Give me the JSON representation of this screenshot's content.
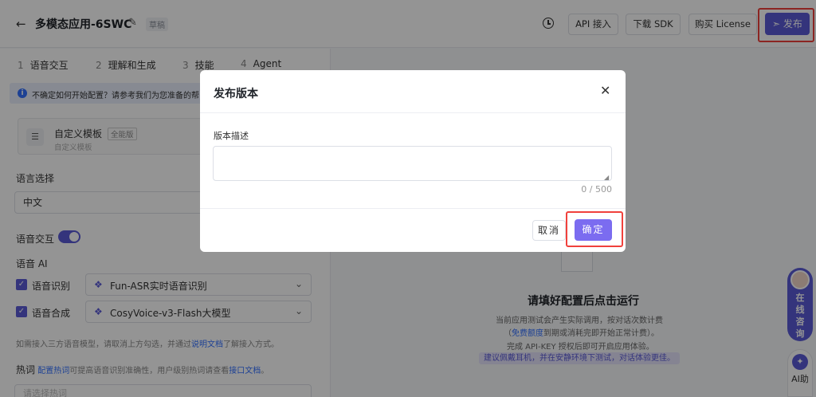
{
  "header": {
    "back_icon": "arrow-left-icon",
    "title": "多模态应用-6SWC",
    "edit_icon": "edit-icon",
    "draft_badge": "草稿",
    "history_icon": "clock-icon",
    "api_button": "API 接入",
    "sdk_button": "下载 SDK",
    "license_button": "购买 License",
    "publish_button": "发布",
    "publish_icon": "send-icon",
    "highlight_color": "#f0413c",
    "accent_color": "#5b5bd6"
  },
  "steps": [
    {
      "num": "1",
      "label": "语音交互"
    },
    {
      "num": "2",
      "label": "理解和生成"
    },
    {
      "num": "3",
      "label": "技能"
    },
    {
      "num": "4",
      "label": "Agent"
    }
  ],
  "info_bar": {
    "icon": "info-icon",
    "text": "不确定如何开始配置？请参考我们为您准备的帮"
  },
  "template": {
    "name": "自定义模板",
    "badge": "全能版",
    "subtitle": "自定义模板",
    "icon": "sliders-icon"
  },
  "language": {
    "label": "语言选择",
    "value": "中文"
  },
  "voice_interaction": {
    "label": "语音交互",
    "enabled": true
  },
  "voice_ai": {
    "label": "语音 AI",
    "asr": {
      "label": "语音识别",
      "model": "Fun-ASR实时语音识别",
      "checked": true
    },
    "tts": {
      "label": "语音合成",
      "model": "CosyVoice-v3-Flash大模型",
      "checked": true
    }
  },
  "third_party_note": {
    "prefix": "如需接入三方语音模型，请取消上方勾选，并通过",
    "link": "说明文档",
    "suffix": "了解接入方式。"
  },
  "hotword": {
    "label": "热词",
    "link1": "配置热词",
    "middle": "可提高语音识别准确性，用户级别热词请查看",
    "link2": "接口文档",
    "end": "。",
    "placeholder": "请选择热词"
  },
  "run_panel": {
    "title": "请填好配置后点击运行",
    "line1": "当前应用测试会产生实际调用，按对话次数计费",
    "line2_open": "（",
    "line2_link": "免费额度",
    "line2_rest": "到期或消耗完即开始正常计费）。",
    "line3": "完成 API-KEY 授权后即可开启应用体验。",
    "tip": "建议佩戴耳机，并在安静环境下测试，对话体验更佳。"
  },
  "float": {
    "chat_text": "在线咨询",
    "ai_text": "AI助"
  },
  "modal": {
    "title": "发布版本",
    "close_icon": "close-icon",
    "field_label": "版本描述",
    "textarea_value": "",
    "counter": "0 / 500",
    "cancel": "取消",
    "confirm": "确定"
  }
}
